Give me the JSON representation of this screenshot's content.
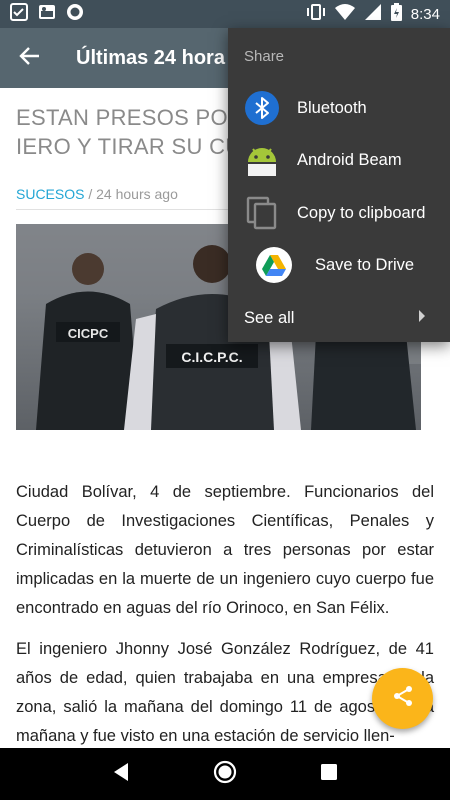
{
  "status_bar": {
    "time": "8:34",
    "left_icons": [
      "checklist-icon",
      "weather-icon",
      "record-icon"
    ],
    "right_icons": [
      "vibrate-icon",
      "wifi-icon",
      "signal-icon",
      "battery-icon"
    ]
  },
  "app_bar": {
    "title": "Últimas 24 hora"
  },
  "article": {
    "headline_line1": "ESTAN PRESOS POR M",
    "headline_line2": "IERO Y TIRAR SU CUER",
    "category": "SUCESOS",
    "separator": " / ",
    "time_ago": "24 hours ago",
    "paragraph1": "Ciudad Bolívar, 4 de septiembre. Funcionarios del Cuerpo de Investigaciones Científicas, Penales y Criminalísticas detuvieron a tres personas por estar implicadas en la muerte de un ingeniero cuyo cuerpo fue encontrado en aguas del río Orinoco, en San Félix.",
    "paragraph2": "El ingeniero Jhonny José González Rodríguez, de 41 años de edad, quien trabajaba en una empresa de la zona, salió la mañana del domingo 11 de agosto en la mañana y fue visto en una estación de servicio llen-",
    "photo_vest_left": "CICPC",
    "photo_vest_right": "C.I.C.P.C."
  },
  "share_menu": {
    "title": "Share",
    "items": [
      {
        "label": "Bluetooth",
        "icon": "bluetooth-icon"
      },
      {
        "label": "Android Beam",
        "icon": "android-icon"
      },
      {
        "label": "Copy to clipboard",
        "icon": "copy-icon"
      },
      {
        "label": "Save to Drive",
        "icon": "drive-icon"
      },
      {
        "label": "See all",
        "icon": "chevron-right-icon"
      }
    ]
  },
  "colors": {
    "status_bar": "#404f59",
    "app_bar": "#56666f",
    "category": "#23a6d5",
    "fab": "#fbb51a",
    "menu_bg": "#3a3a3a",
    "bluetooth": "#1f6fd1",
    "android": "#a4c639"
  }
}
